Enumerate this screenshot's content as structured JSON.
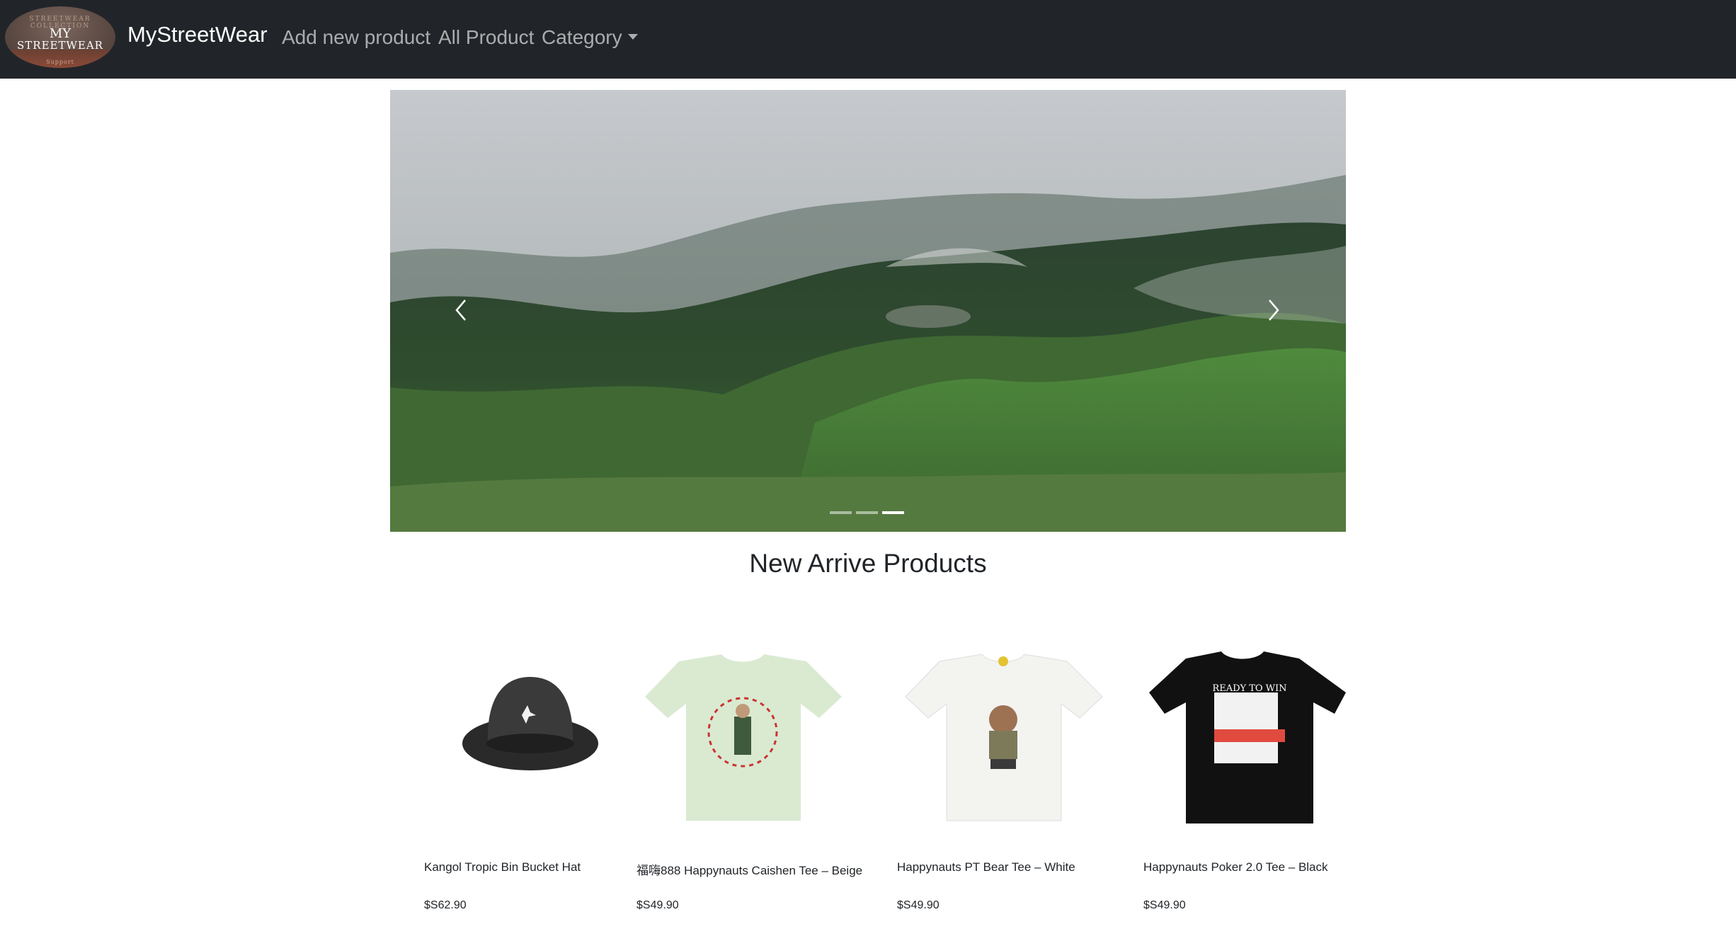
{
  "navbar": {
    "logo": {
      "top_text": "STREETWEAR COLLECTION",
      "line1": "MY",
      "line2": "STREETWEAR",
      "bottom_text": "Support"
    },
    "brand": "MyStreetWear",
    "links": {
      "add_new_product": "Add new product",
      "all_product": "All Product",
      "category": "Category"
    }
  },
  "carousel": {
    "slides": 3,
    "active_index": 2
  },
  "section": {
    "title": "New Arrive Products"
  },
  "products": [
    {
      "name": "Kangol Tropic Bin Bucket Hat",
      "price": "$S62.90"
    },
    {
      "name": "福嗨888 Happynauts Caishen Tee – Beige",
      "price": "$S49.90"
    },
    {
      "name": "Happynauts PT Bear Tee – White",
      "price": "$S49.90"
    },
    {
      "name": "Happynauts Poker 2.0 Tee – Black",
      "price": "$S49.90"
    }
  ],
  "colors": {
    "navbar_bg": "#212529",
    "text": "#212529",
    "nav_link": "rgba(255,255,255,0.62)"
  }
}
